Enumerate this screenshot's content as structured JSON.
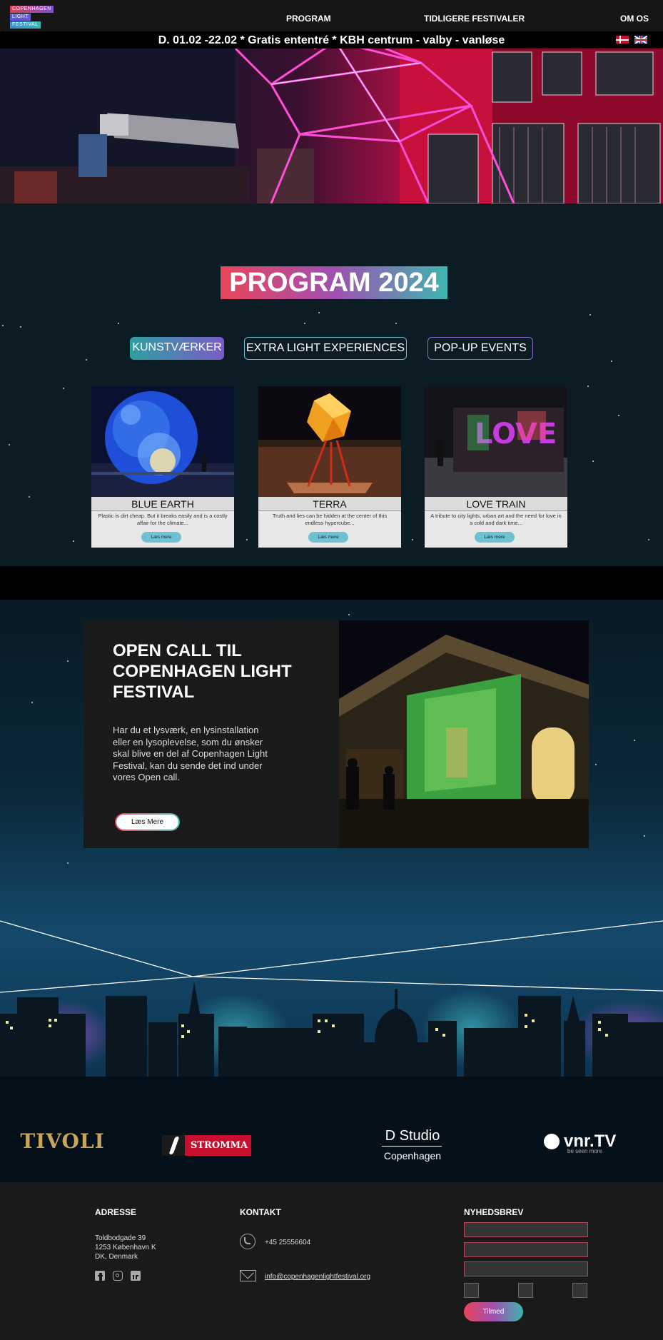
{
  "nav": {
    "logo": [
      "COPENHAGEN",
      "LIGHT",
      "FESTIVAL"
    ],
    "links": [
      "PROGRAM",
      "TIDLIGERE FESTIVALER",
      "OM OS"
    ]
  },
  "ticker": {
    "text": "D. 01.02 -22.02 * Gratis ententré  * KBH centrum - valby - vanløse"
  },
  "program": {
    "title": "PROGRAM 2024",
    "filters": [
      "KUNSTVÆRKER",
      "EXTRA LIGHT EXPERIENCES",
      "POP-UP EVENTS"
    ],
    "cards": [
      {
        "title": "BLUE EARTH",
        "desc": "Plastic is dirt cheap. But it breaks easily and is a costly affair for the climate...",
        "button": "Læs mere"
      },
      {
        "title": "TERRA",
        "desc": "Truth and lies can be hidden at the center of this endless hypercube...",
        "button": "Læs mere"
      },
      {
        "title": "LOVE TRAIN",
        "desc": "A tribute to city lights, urban art and the need for love in a cold and dark time...",
        "button": "Læs mere"
      }
    ]
  },
  "opencall": {
    "title": "OPEN CALL TIL COPENHAGEN LIGHT FESTIVAL",
    "text": "Har du et lysværk, en lysinstallation eller en lysoplevelse, som du ønsker skal blive en del af Copenhagen Light Festival, kan du sende det ind under vores Open call.",
    "button": "Læs Mere"
  },
  "sponsors": {
    "tivoli": "TIVOLI",
    "stromma": "STROMMA",
    "dstudio": "D Studio",
    "dstudio_sub": "Copenhagen",
    "vnr": "vnr.TV",
    "vnr_sub": "be seen more"
  },
  "footer": {
    "address_head": "ADRESSE",
    "address_lines": [
      "Toldbodgade 39",
      "1253 København K",
      "DK, Denmark"
    ],
    "contact_head": "KONTAKT",
    "phone": "+45 25556604",
    "email": "info@copenhagenlightfestival.org",
    "newsletter_head": "NYHEDSBREV",
    "subscribe": "Tilmed"
  },
  "colors": {
    "accent_red": "#e8455a",
    "accent_purple": "#a050b0",
    "accent_teal": "#3fb5b0"
  }
}
